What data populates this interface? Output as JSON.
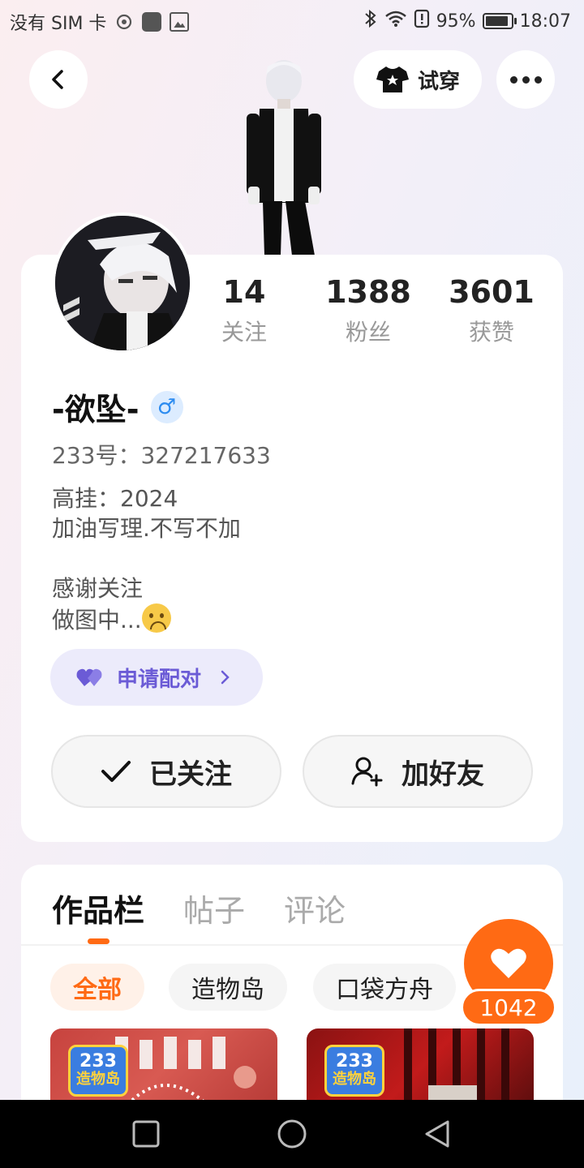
{
  "status_bar": {
    "carrier": "没有 SIM 卡",
    "battery": "95%",
    "time": "18:07"
  },
  "header": {
    "back_icon": "chevron-left-icon",
    "tryon_label": "试穿",
    "tryon_icon": "shirt-icon",
    "more_icon": "more-dots-icon"
  },
  "profile": {
    "nickname": "-欲坠-",
    "gender_symbol": "♂",
    "uid_text": "233号：327217633",
    "bio": "高挂：2024\n加油写理.不写不加\n\n感谢关注\n做图中...",
    "stats": [
      {
        "num": "14",
        "label": "关注"
      },
      {
        "num": "1388",
        "label": "粉丝"
      },
      {
        "num": "3601",
        "label": "获赞"
      }
    ],
    "pair_label": "申请配对",
    "follow_label": "已关注",
    "add_friend_label": "加好友"
  },
  "works": {
    "tabs": [
      {
        "label": "作品栏",
        "active": true
      },
      {
        "label": "帖子",
        "active": false
      },
      {
        "label": "评论",
        "active": false
      }
    ],
    "chips": [
      {
        "label": "全部",
        "active": true
      },
      {
        "label": "造物岛",
        "active": false
      },
      {
        "label": "口袋方舟",
        "active": false
      }
    ],
    "thumb_badge_number": "233",
    "thumb_badge_text": "造物岛"
  },
  "like": {
    "count": "1042"
  },
  "colors": {
    "accent": "#ff6a14",
    "pair": "#6b5bd6",
    "gender": "#2d8cf0"
  }
}
